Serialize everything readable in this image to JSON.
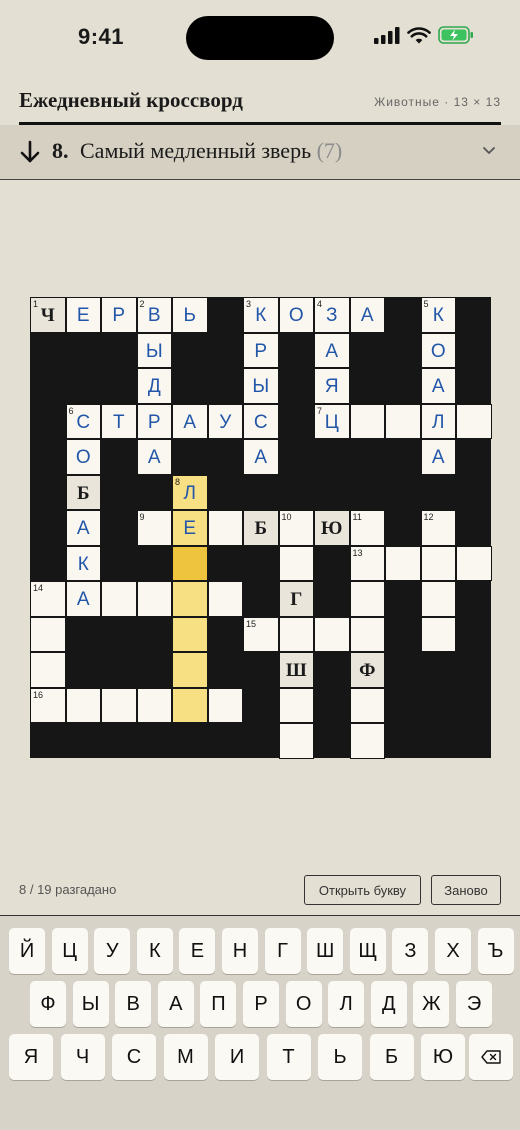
{
  "status_bar": {
    "time": "9:41"
  },
  "header": {
    "title": "Ежедневный кроссворд",
    "meta": "Животные · 13 × 13"
  },
  "clue_bar": {
    "number": "8.",
    "text": "Самый медленный зверь",
    "length": "(7)"
  },
  "grid": {
    "size": 13,
    "active_clue": 8,
    "direction": "down",
    "active_cell": [
      7,
      4
    ],
    "cells": [
      {
        "r": 0,
        "c": 0,
        "n": 1,
        "ch": "Ч",
        "pre": true
      },
      {
        "r": 0,
        "c": 1,
        "ch": "Е"
      },
      {
        "r": 0,
        "c": 2,
        "ch": "Р"
      },
      {
        "r": 0,
        "c": 3,
        "n": 2,
        "ch": "В"
      },
      {
        "r": 0,
        "c": 4,
        "ch": "Ь"
      },
      {
        "r": 0,
        "c": 6,
        "n": 3,
        "ch": "К"
      },
      {
        "r": 0,
        "c": 7,
        "ch": "О"
      },
      {
        "r": 0,
        "c": 8,
        "n": 4,
        "ch": "З"
      },
      {
        "r": 0,
        "c": 9,
        "ch": "А"
      },
      {
        "r": 0,
        "c": 11,
        "n": 5,
        "ch": "К"
      },
      {
        "r": 1,
        "c": 3,
        "ch": "Ы"
      },
      {
        "r": 1,
        "c": 6,
        "ch": "Р"
      },
      {
        "r": 1,
        "c": 8,
        "ch": "А"
      },
      {
        "r": 1,
        "c": 11,
        "ch": "О"
      },
      {
        "r": 2,
        "c": 3,
        "ch": "Д"
      },
      {
        "r": 2,
        "c": 6,
        "ch": "Ы"
      },
      {
        "r": 2,
        "c": 8,
        "ch": "Я"
      },
      {
        "r": 2,
        "c": 11,
        "ch": "А"
      },
      {
        "r": 3,
        "c": 1,
        "n": 6,
        "ch": "С"
      },
      {
        "r": 3,
        "c": 2,
        "ch": "Т"
      },
      {
        "r": 3,
        "c": 3,
        "ch": "Р"
      },
      {
        "r": 3,
        "c": 4,
        "ch": "А"
      },
      {
        "r": 3,
        "c": 5,
        "ch": "У"
      },
      {
        "r": 3,
        "c": 6,
        "ch": "С"
      },
      {
        "r": 3,
        "c": 8,
        "n": 7,
        "ch": "Ц"
      },
      {
        "r": 3,
        "c": 9,
        "ch": ""
      },
      {
        "r": 3,
        "c": 10,
        "ch": ""
      },
      {
        "r": 3,
        "c": 11,
        "ch": "Л"
      },
      {
        "r": 3,
        "c": 12,
        "ch": ""
      },
      {
        "r": 4,
        "c": 1,
        "ch": "О"
      },
      {
        "r": 4,
        "c": 3,
        "ch": "А"
      },
      {
        "r": 4,
        "c": 6,
        "ch": "А"
      },
      {
        "r": 4,
        "c": 11,
        "ch": "А"
      },
      {
        "r": 5,
        "c": 1,
        "ch": "Б",
        "pre": true
      },
      {
        "r": 5,
        "c": 4,
        "n": 8,
        "ch": "Л"
      },
      {
        "r": 6,
        "c": 1,
        "ch": "А"
      },
      {
        "r": 6,
        "c": 3,
        "n": 9,
        "ch": ""
      },
      {
        "r": 6,
        "c": 4,
        "ch": "Е"
      },
      {
        "r": 6,
        "c": 5,
        "ch": ""
      },
      {
        "r": 6,
        "c": 6,
        "ch": "Б",
        "pre": true
      },
      {
        "r": 6,
        "c": 7,
        "n": 10,
        "ch": ""
      },
      {
        "r": 6,
        "c": 8,
        "ch": "Ю",
        "pre": true
      },
      {
        "r": 6,
        "c": 9,
        "n": 11,
        "ch": ""
      },
      {
        "r": 6,
        "c": 11,
        "n": 12,
        "ch": ""
      },
      {
        "r": 7,
        "c": 1,
        "ch": "К"
      },
      {
        "r": 7,
        "c": 4,
        "ch": ""
      },
      {
        "r": 7,
        "c": 7,
        "ch": ""
      },
      {
        "r": 7,
        "c": 9,
        "n": 13,
        "ch": ""
      },
      {
        "r": 7,
        "c": 10,
        "ch": ""
      },
      {
        "r": 7,
        "c": 11,
        "ch": ""
      },
      {
        "r": 7,
        "c": 12,
        "ch": ""
      },
      {
        "r": 8,
        "c": 0,
        "n": 14,
        "ch": ""
      },
      {
        "r": 8,
        "c": 1,
        "ch": "А"
      },
      {
        "r": 8,
        "c": 2,
        "ch": ""
      },
      {
        "r": 8,
        "c": 3,
        "ch": ""
      },
      {
        "r": 8,
        "c": 4,
        "ch": ""
      },
      {
        "r": 8,
        "c": 5,
        "ch": ""
      },
      {
        "r": 8,
        "c": 7,
        "ch": "Г",
        "pre": true
      },
      {
        "r": 8,
        "c": 9,
        "ch": ""
      },
      {
        "r": 8,
        "c": 11,
        "ch": ""
      },
      {
        "r": 9,
        "c": 0,
        "ch": ""
      },
      {
        "r": 9,
        "c": 4,
        "ch": ""
      },
      {
        "r": 9,
        "c": 6,
        "n": 15,
        "ch": ""
      },
      {
        "r": 9,
        "c": 7,
        "ch": ""
      },
      {
        "r": 9,
        "c": 8,
        "ch": ""
      },
      {
        "r": 9,
        "c": 9,
        "ch": ""
      },
      {
        "r": 9,
        "c": 11,
        "ch": ""
      },
      {
        "r": 10,
        "c": 0,
        "ch": ""
      },
      {
        "r": 10,
        "c": 4,
        "ch": ""
      },
      {
        "r": 10,
        "c": 7,
        "ch": "Ш",
        "pre": true
      },
      {
        "r": 10,
        "c": 9,
        "ch": "Ф",
        "pre": true
      },
      {
        "r": 11,
        "c": 0,
        "n": 16,
        "ch": ""
      },
      {
        "r": 11,
        "c": 1,
        "ch": ""
      },
      {
        "r": 11,
        "c": 2,
        "ch": ""
      },
      {
        "r": 11,
        "c": 3,
        "ch": ""
      },
      {
        "r": 11,
        "c": 4,
        "ch": ""
      },
      {
        "r": 11,
        "c": 5,
        "ch": ""
      },
      {
        "r": 11,
        "c": 7,
        "ch": ""
      },
      {
        "r": 11,
        "c": 9,
        "ch": ""
      },
      {
        "r": 12,
        "c": 7,
        "ch": ""
      },
      {
        "r": 12,
        "c": 9,
        "ch": ""
      }
    ]
  },
  "footer": {
    "progress": "8 / 19 разгадано",
    "reveal_label": "Открыть букву",
    "reset_label": "Заново"
  },
  "keyboard": {
    "rows": [
      [
        "Й",
        "Ц",
        "У",
        "К",
        "Е",
        "Н",
        "Г",
        "Ш",
        "Щ",
        "З",
        "Х",
        "Ъ"
      ],
      [
        "Ф",
        "Ы",
        "В",
        "А",
        "П",
        "Р",
        "О",
        "Л",
        "Д",
        "Ж",
        "Э"
      ],
      [
        "Я",
        "Ч",
        "С",
        "М",
        "И",
        "Т",
        "Ь",
        "Б",
        "Ю"
      ]
    ],
    "backspace_icon": "backspace-icon"
  },
  "colors": {
    "background": "#e4dfd3",
    "grid_black": "#161616",
    "cell_white": "#faf7f0",
    "entered_letter": "#2156a8",
    "active_word": "#f7df83",
    "active_cell": "#eec43e"
  }
}
